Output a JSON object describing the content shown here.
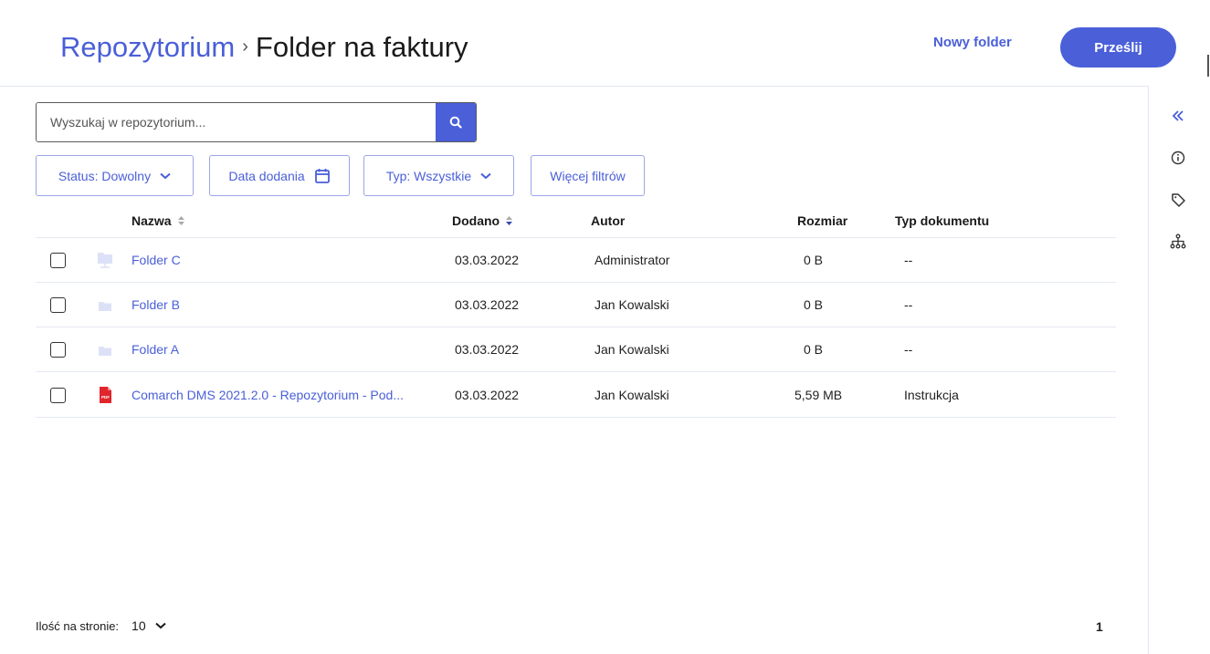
{
  "header": {
    "breadcrumb_root": "Repozytorium",
    "breadcrumb_separator": "›",
    "breadcrumb_current": "Folder na faktury",
    "new_folder_label": "Nowy folder",
    "upload_label": "Prześlij"
  },
  "search": {
    "placeholder": "Wyszukaj w repozytorium...",
    "icon": "search-icon"
  },
  "filters": {
    "status": "Status: Dowolny",
    "date_added": "Data dodania",
    "type": "Typ: Wszystkie",
    "more": "Więcej filtrów"
  },
  "table": {
    "headers": {
      "name": "Nazwa",
      "added": "Dodano",
      "author": "Autor",
      "size": "Rozmiar",
      "doc_type": "Typ dokumentu"
    },
    "rows": [
      {
        "name": "Folder C",
        "added": "03.03.2022",
        "author": "Administrator",
        "size": "0 B",
        "doc_type": "--",
        "icon": "shared-folder-icon"
      },
      {
        "name": "Folder B",
        "added": "03.03.2022",
        "author": "Jan Kowalski",
        "size": "0 B",
        "doc_type": "--",
        "icon": "folder-icon"
      },
      {
        "name": "Folder A",
        "added": "03.03.2022",
        "author": "Jan Kowalski",
        "size": "0 B",
        "doc_type": "--",
        "icon": "folder-icon"
      },
      {
        "name": "Comarch DMS 2021.2.0 - Repozytorium - Pod...",
        "added": "03.03.2022",
        "author": "Jan Kowalski",
        "size": "5,59 MB",
        "doc_type": "Instrukcja",
        "icon": "pdf-icon"
      }
    ]
  },
  "footer": {
    "page_size_label": "Ilość na stronie:",
    "page_size_value": "10",
    "page_number": "1"
  },
  "rail": {
    "icons": [
      "collapse-double-chevron-icon",
      "info-icon",
      "tag-icon",
      "hierarchy-icon"
    ]
  },
  "colors": {
    "accent": "#4a5fd8",
    "folder": "#dde1f7",
    "pdf": "#e0262c"
  }
}
